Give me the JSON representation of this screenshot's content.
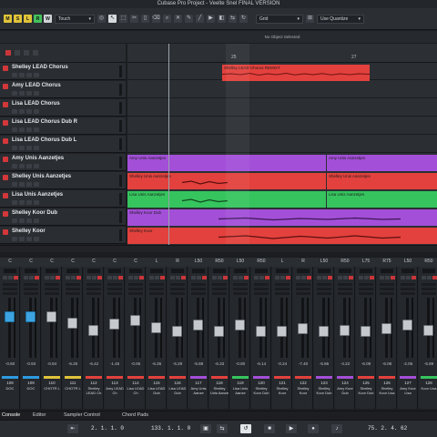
{
  "window": {
    "title": "Cubase Pro Project - Veelte Snel FINAL VERSION"
  },
  "toolbar": {
    "mode_buttons": [
      {
        "label": "M",
        "color": "#e0c43a"
      },
      {
        "label": "S",
        "color": "#e0c43a"
      },
      {
        "label": "L",
        "color": "#e0c43a"
      },
      {
        "label": "R",
        "color": "#44c15c"
      },
      {
        "label": "W",
        "color": "#d0d3d6"
      }
    ],
    "automation_mode": "Touch",
    "snap_type": "Grid",
    "quantize": "Use Quantize"
  },
  "info_line": "No Object Selected",
  "ruler": {
    "ticks": [
      "25",
      "27"
    ]
  },
  "tracks": [
    {
      "name": "Shelley LEAD Chorus"
    },
    {
      "name": "Amy LEAD Chorus"
    },
    {
      "name": "Lisa LEAD Chorus"
    },
    {
      "name": "Lisa LEAD Chorus Dub R"
    },
    {
      "name": "Lisa LEAD Chorus Dub L"
    },
    {
      "name": "Amy Unis Aanzetjes"
    },
    {
      "name": "Shelley Unis Aanzetjes"
    },
    {
      "name": "Lisa Unis Aanzetjes"
    },
    {
      "name": "Shelley Koor Dub"
    },
    {
      "name": "Shelley Koor"
    }
  ],
  "clips": [
    {
      "label": "Shelley LEAD Chorus REMIXT",
      "color": "#e3413d"
    },
    {
      "label": "Amy Unis Aanzetjes",
      "color": "#a34fd8"
    },
    {
      "label": "Amy Unis Aanzetjes",
      "color": "#a34fd8"
    },
    {
      "label": "Shelley Unis Aanzetjes",
      "color": "#e3413d"
    },
    {
      "label": "Shelley Unis Aanzetjes",
      "color": "#e3413d"
    },
    {
      "label": "Lisa Unis Aanzetjes",
      "color": "#36c45e"
    },
    {
      "label": "Lisa Unis Aanzetjes",
      "color": "#36c45e"
    },
    {
      "label": "Shelley Koor Dub",
      "color": "#a34fd8"
    },
    {
      "label": "Shelley Koor",
      "color": "#e3413d"
    }
  ],
  "mixer": {
    "channels": [
      {
        "pan": "C",
        "value": "-0.60",
        "num": "108",
        "name": "DOC",
        "color": "#2e9be0"
      },
      {
        "pan": "C",
        "value": "-0.93",
        "num": "109",
        "name": "DOC",
        "color": "#2e9be0"
      },
      {
        "pan": "C",
        "value": "-0.84",
        "num": "110",
        "name": "CHOTR L",
        "color": "#e0c43a"
      },
      {
        "pan": "C",
        "value": "-6.25",
        "num": "111",
        "name": "CHOTR L",
        "color": "#e0c43a"
      },
      {
        "pan": "C",
        "value": "-6.42",
        "num": "112",
        "name": "Shelley LEAD Ch",
        "color": "#e3413d"
      },
      {
        "pan": "C",
        "value": "-1.45",
        "num": "113",
        "name": "Amy LEAD Ch",
        "color": "#e3413d"
      },
      {
        "pan": "C",
        "value": "-0.06",
        "num": "114",
        "name": "Lisa LEAD Ch",
        "color": "#e3413d"
      },
      {
        "pan": "L",
        "value": "-6.26",
        "num": "115",
        "name": "Lisa LEAD Dub",
        "color": "#e3413d"
      },
      {
        "pan": "R",
        "value": "-6.29",
        "num": "116",
        "name": "Lisa LEAD Dub",
        "color": "#e3413d"
      },
      {
        "pan": "L50",
        "value": "-5.88",
        "num": "117",
        "name": "Amy Unis Aanze",
        "color": "#a34fd8"
      },
      {
        "pan": "R50",
        "value": "-6.33",
        "num": "118",
        "name": "Shelley Unis Aanze",
        "color": "#e3413d"
      },
      {
        "pan": "L50",
        "value": "-0.80",
        "num": "119",
        "name": "Lisa Unis Aanze",
        "color": "#36c45e"
      },
      {
        "pan": "R50",
        "value": "-6.14",
        "num": "120",
        "name": "Shelley Koor Dub",
        "color": "#a34fd8"
      },
      {
        "pan": "L",
        "value": "-0.24",
        "num": "121",
        "name": "Shelley Koor",
        "color": "#e3413d"
      },
      {
        "pan": "R",
        "value": "-7.40",
        "num": "122",
        "name": "Shelley Koor",
        "color": "#e3413d"
      },
      {
        "pan": "L50",
        "value": "-5.86",
        "num": "123",
        "name": "Shelley Koor Dub",
        "color": "#a34fd8"
      },
      {
        "pan": "R50",
        "value": "-4.22",
        "num": "124",
        "name": "Amy Koor Dub",
        "color": "#a34fd8"
      },
      {
        "pan": "L75",
        "value": "-6.09",
        "num": "125",
        "name": "Shelley Koor Dub",
        "color": "#e3413d"
      },
      {
        "pan": "R75",
        "value": "-6.08",
        "num": "126",
        "name": "Shelley Koor Lisa",
        "color": "#e3413d"
      },
      {
        "pan": "L50",
        "value": "-2.06",
        "num": "127",
        "name": "Amy Koor Lisa",
        "color": "#a34fd8"
      },
      {
        "pan": "R50",
        "value": "-5.89",
        "num": "128",
        "name": "Koor Lisa",
        "color": "#36c45e"
      }
    ],
    "fader_levels": [
      0.72,
      0.72,
      0.72,
      0.6,
      0.45,
      0.58,
      0.64,
      0.5,
      0.43,
      0.56,
      0.43,
      0.55,
      0.43,
      0.43,
      0.48,
      0.43,
      0.45,
      0.43,
      0.48,
      0.56,
      0.45
    ]
  },
  "bottom_tabs": [
    "Console",
    "Editor",
    "Sampler Control",
    "Chord Pads"
  ],
  "transport": {
    "left_locator": "2. 1. 1. 0",
    "right_locator": "133. 1. 1. 0",
    "position": "75. 2. 4. 62"
  }
}
